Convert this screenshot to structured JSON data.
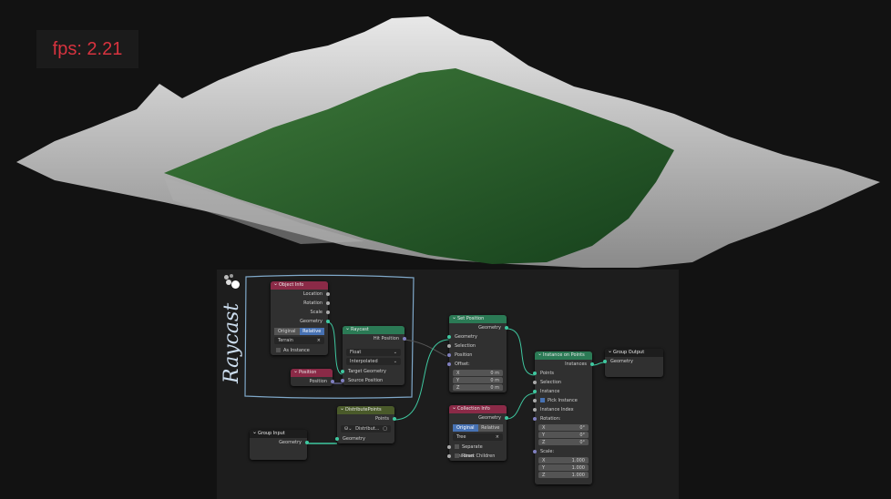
{
  "viewport": {
    "fps_label": "fps: 2.21"
  },
  "colors": {
    "input_header": "#8b2a47",
    "geometry_header": "#2b7a55",
    "distribute_header": "#4a5a2a",
    "socket_geometry": "#3fc8a0",
    "frame_outline": "#7fa8c9"
  },
  "frame": {
    "label": "Raycast"
  },
  "object_info": {
    "title": "Object Info",
    "outputs": [
      "Location",
      "Rotation",
      "Scale",
      "Geometry"
    ],
    "toggle": [
      "Original",
      "Relative"
    ],
    "object": "Terrain",
    "as_instance": "As Instance"
  },
  "position": {
    "title": "Position",
    "output": "Position"
  },
  "raycast": {
    "title": "Raycast",
    "output": "Hit Position",
    "type": "Float",
    "mapping": "Interpolated",
    "inputs": [
      "Target Geometry",
      "Source Position"
    ]
  },
  "set_position": {
    "title": "Set Position",
    "output": "Geometry",
    "inputs": [
      "Geometry",
      "Selection",
      "Position",
      "Offset:"
    ],
    "offset": [
      {
        "axis": "X",
        "value": "0 m"
      },
      {
        "axis": "Y",
        "value": "0 m"
      },
      {
        "axis": "Z",
        "value": "0 m"
      }
    ]
  },
  "instance_on_points": {
    "title": "Instance on Points",
    "output": "Instances",
    "inputs": [
      "Points",
      "Selection",
      "Instance"
    ],
    "pick_instance": "Pick Instance",
    "instance_index": "Instance Index",
    "rotation_label": "Rotation:",
    "rotation": [
      {
        "axis": "X",
        "value": "0°"
      },
      {
        "axis": "Y",
        "value": "0°"
      },
      {
        "axis": "Z",
        "value": "0°"
      }
    ],
    "scale_label": "Scale:",
    "scale": [
      {
        "axis": "X",
        "value": "1.000"
      },
      {
        "axis": "Y",
        "value": "1.000"
      },
      {
        "axis": "Z",
        "value": "1.000"
      }
    ]
  },
  "group_output": {
    "title": "Group Output",
    "input": "Geometry"
  },
  "group_input": {
    "title": "Group Input",
    "output": "Geometry"
  },
  "distribute_points": {
    "title": "DistributePoints",
    "output": "Points",
    "tree": "Distribut...",
    "input": "Geometry"
  },
  "collection_info": {
    "title": "Collection Info",
    "output": "Geometry",
    "toggle": [
      "Original",
      "Relative"
    ],
    "collection": "Tree",
    "separate": "Separate Children",
    "reset": "Reset Children"
  }
}
